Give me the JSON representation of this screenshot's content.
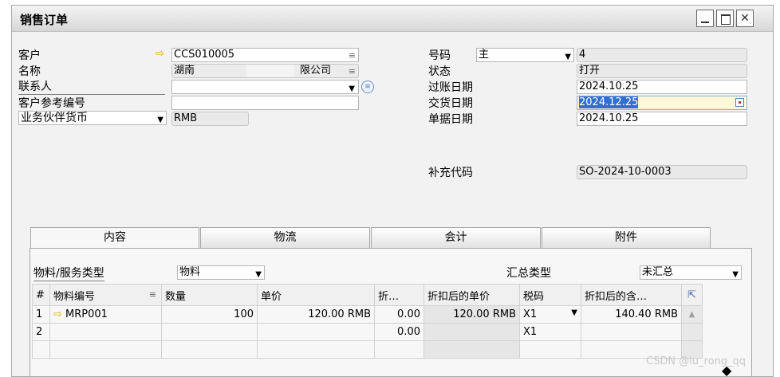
{
  "window": {
    "title": "销售订单"
  },
  "left_form": {
    "customer_label": "客户",
    "customer_value": "CCS010005",
    "name_label": "名称",
    "name_value_start": "湖南",
    "name_value_end": "限公司",
    "contact_label": "联系人",
    "contact_value": "",
    "customer_ref_label": "客户参考编号",
    "customer_ref_value": "",
    "currency_label": "业务伙伴货币",
    "currency_value": "RMB"
  },
  "right_form": {
    "number_label": "号码",
    "number_series": "主",
    "number_value": "4",
    "status_label": "状态",
    "status_value": "打开",
    "posting_date_label": "过账日期",
    "posting_date_value": "2024.10.25",
    "delivery_date_label": "交货日期",
    "delivery_date_value": "2024.12.25",
    "document_date_label": "单据日期",
    "document_date_value": "2024.10.25",
    "supplement_code_label": "补充代码",
    "supplement_code_value": "SO-2024-10-0003"
  },
  "tabs": [
    "内容",
    "物流",
    "会计",
    "附件"
  ],
  "content": {
    "item_type_label": "物料/服务类型",
    "item_type_value": "物料",
    "summary_type_label": "汇总类型",
    "summary_type_value": "未汇总"
  },
  "grid": {
    "headers": [
      "#",
      "物料编号",
      "数量",
      "单价",
      "折…",
      "折扣后的单价",
      "税码",
      "折扣后的含…"
    ],
    "rows": [
      {
        "no": "1",
        "item": "MRP001",
        "qty": "100",
        "price": "120.00 RMB",
        "disc": "0.00",
        "net_price": "120.00 RMB",
        "tax": "X1",
        "gross": "140.40 RMB"
      },
      {
        "no": "2",
        "item": "",
        "qty": "",
        "price": "",
        "disc": "0.00",
        "net_price": "",
        "tax": "X1",
        "gross": ""
      }
    ]
  },
  "watermark": "CSDN @lu_rong_qq"
}
